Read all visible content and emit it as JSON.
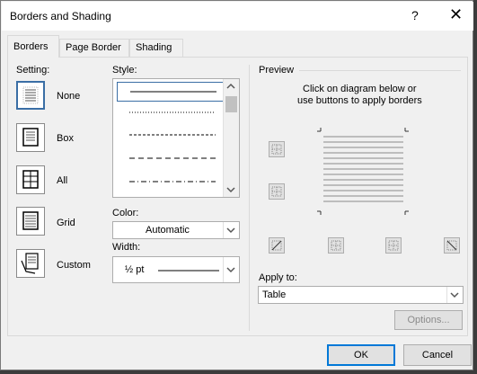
{
  "window": {
    "title": "Borders and Shading",
    "help_glyph": "?",
    "close_glyph": "✕"
  },
  "tabs": [
    {
      "label": "Borders",
      "active": true
    },
    {
      "label": "Page Border",
      "active": false
    },
    {
      "label": "Shading",
      "active": false
    }
  ],
  "setting": {
    "heading": "Setting:",
    "options": [
      {
        "label": "None",
        "selected": true,
        "icon": "setting-none-icon"
      },
      {
        "label": "Box",
        "selected": false,
        "icon": "setting-box-icon"
      },
      {
        "label": "All",
        "selected": false,
        "icon": "setting-all-icon"
      },
      {
        "label": "Grid",
        "selected": false,
        "icon": "setting-grid-icon"
      },
      {
        "label": "Custom",
        "selected": false,
        "icon": "setting-custom-icon"
      }
    ]
  },
  "style": {
    "heading": "Style:",
    "items": [
      "solid",
      "dotted",
      "dashed-small",
      "dashed",
      "dash-dot"
    ],
    "selected_index": 0
  },
  "color": {
    "label": "Color:",
    "value": "Automatic"
  },
  "width": {
    "label": "Width:",
    "value": "½ pt"
  },
  "preview": {
    "heading": "Preview",
    "instructions_line1": "Click on diagram below or",
    "instructions_line2": "use buttons to apply borders"
  },
  "apply_to": {
    "label": "Apply to:",
    "value": "Table"
  },
  "buttons": {
    "options": "Options...",
    "ok": "OK",
    "cancel": "Cancel"
  },
  "colors": {
    "accent": "#0078d7",
    "selection": "#3a6ea5",
    "background": "#f0f0f0"
  }
}
